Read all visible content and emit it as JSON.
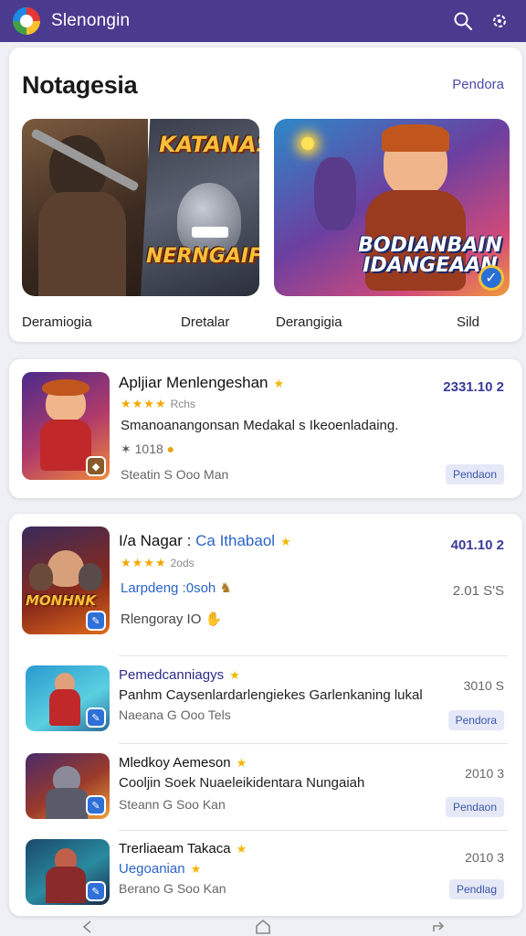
{
  "app": {
    "title": "Slenongin"
  },
  "icons": {
    "search": "search-icon",
    "settings": "gear-icon"
  },
  "featured": {
    "title": "Notagesia",
    "see_more": "Pendora",
    "banners": [
      {
        "text_top": "KATANAS",
        "text_bottom": "NERNGAIF"
      },
      {
        "text": "BODIANBAIN IDANGEAAN"
      }
    ],
    "labels": [
      "Deramiogia",
      "Dretalar",
      "Derangigia",
      "Sild"
    ]
  },
  "card_app": {
    "name": "Apljiar Menlengeshan",
    "rating_text": "Rchs",
    "description": "Smanoanangonsan Medakal s Ikeoenladaing.",
    "count": "1018",
    "meta": "Steatin S Ooo Man",
    "price": "2331.10 2",
    "button": "Pendaon"
  },
  "list": [
    {
      "name": "I/a Nagar",
      "name_link": "Ca Ithabaol",
      "rating_text": "2ods",
      "sub_link": "Larpdeng :0soh",
      "meta": "Rlengoray IO",
      "price": "401.10 2",
      "price2": "2.01 S'S",
      "thumb_text": "MONHNK"
    },
    {
      "name": "Pemedcanniagys",
      "description": "Panhm Caysenlardarlengiekes Garlenkaning lukal",
      "meta": "Naeana G Ooo Tels",
      "price": "3010 S",
      "button": "Pendora"
    },
    {
      "name": "Mledkoy Aemeson",
      "description": "Cooljin Soek Nuaeleikidentara Nungaiah",
      "meta": "Steann G Soo Kan",
      "price": "2010 3",
      "button": "Pendaon"
    },
    {
      "name": "Trerliaeam Takaca",
      "name_sub": "Uegoanian",
      "meta": "Berano G Soo Kan",
      "price": "2010 3",
      "button": "Pendlag"
    }
  ]
}
